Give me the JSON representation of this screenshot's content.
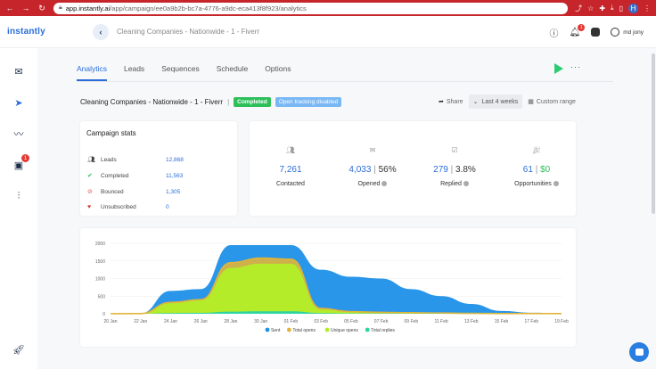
{
  "browser": {
    "url_host": "app.instantly.ai",
    "url_path": "/app/campaign/ee0a9b2b-bc7a-4776-a9dc-eca413f8f923/analytics",
    "profile_initial": "H"
  },
  "header": {
    "logo": "instantly",
    "campaign_title": "Cleaning Companies - Nationwide - 1 - Fiverr",
    "notification_count": "1",
    "user_name": "md jony"
  },
  "sidebar": {
    "items": [
      {
        "icon": "mail-icon"
      },
      {
        "icon": "send-icon"
      },
      {
        "icon": "analytics-icon"
      },
      {
        "icon": "inbox-icon",
        "badge": "1"
      },
      {
        "icon": "settings-sliders-icon"
      },
      {
        "icon": "rocket-icon"
      }
    ]
  },
  "tabs": [
    "Analytics",
    "Leads",
    "Sequences",
    "Schedule",
    "Options"
  ],
  "campaign": {
    "name": "Cleaning Companies - Nationwide - 1 - Fiverr",
    "separator": "|",
    "status": "Completed",
    "tracking": "Open tracking disabled"
  },
  "controls": {
    "share": "Share",
    "range": "Last 4 weeks",
    "custom": "Custom range"
  },
  "stats": {
    "title": "Campaign stats",
    "rows": [
      {
        "label": "Leads",
        "value": "12,868"
      },
      {
        "label": "Completed",
        "value": "11,563"
      },
      {
        "label": "Bounced",
        "value": "1,305"
      },
      {
        "label": "Unsubscribed",
        "value": "0"
      }
    ]
  },
  "metrics": [
    {
      "value": "7,261",
      "extra": "",
      "label": "Contacted"
    },
    {
      "value": "4,033",
      "extra": "56%",
      "label": "Opened"
    },
    {
      "value": "279",
      "extra": "3.8%",
      "label": "Replied"
    },
    {
      "value": "61",
      "extra": "$0",
      "label": "Opportunities"
    }
  ],
  "colors": {
    "accent": "#2a6dd9",
    "sent": "#1e90e8",
    "total_opens": "#e0b43a",
    "unique_opens": "#b4ec2a",
    "total_replies": "#2ed3a0",
    "completed_badge": "#2ebf5a",
    "tracking_badge": "#7ab8f5"
  },
  "chart_data": {
    "type": "area",
    "x": [
      "20 Jan",
      "22 Jan",
      "24 Jan",
      "26 Jan",
      "28 Jan",
      "30 Jan",
      "01 Feb",
      "03 Feb",
      "05 Feb",
      "07 Feb",
      "09 Feb",
      "11 Feb",
      "13 Feb",
      "15 Feb",
      "17 Feb",
      "19 Feb"
    ],
    "y_ticks": [
      "0",
      "500",
      "1000",
      "1500",
      "2000"
    ],
    "ylim": [
      0,
      2000
    ],
    "series": [
      {
        "name": "Sent",
        "values": [
          0,
          10,
          650,
          700,
          1950,
          1950,
          1950,
          1250,
          1050,
          1000,
          700,
          500,
          280,
          80,
          30,
          20
        ]
      },
      {
        "name": "Total opens",
        "values": [
          0,
          5,
          320,
          400,
          1450,
          1580,
          1550,
          150,
          60,
          40,
          30,
          20,
          10,
          5,
          5,
          5
        ]
      },
      {
        "name": "Unique opens",
        "values": [
          0,
          3,
          300,
          380,
          1300,
          1420,
          1420,
          120,
          50,
          30,
          25,
          15,
          8,
          4,
          4,
          4
        ]
      },
      {
        "name": "Total replies",
        "values": [
          0,
          1,
          20,
          25,
          60,
          70,
          70,
          20,
          10,
          8,
          5,
          4,
          2,
          1,
          1,
          1
        ]
      }
    ],
    "legend_position": "bottom"
  }
}
